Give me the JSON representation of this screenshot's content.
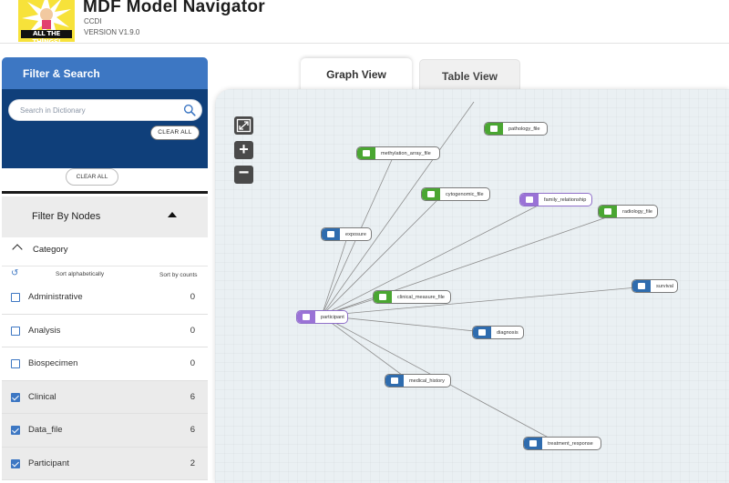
{
  "header": {
    "logo_banner": "ALL THE THINGS!",
    "title": "MDF Model Navigator",
    "subtitle": "CCDI",
    "version": "VERSION V1.9.0"
  },
  "filter": {
    "title": "Filter & Search",
    "search_placeholder": "Search in Dictionary",
    "clear_all_1": "CLEAR ALL",
    "clear_all_2": "CLEAR ALL",
    "filter_by_nodes": "Filter By Nodes",
    "category_label": "Category",
    "sort_alpha": "Sort alphabetically",
    "sort_counts": "Sort by counts",
    "categories": [
      {
        "label": "Administrative",
        "count": "0",
        "checked": false
      },
      {
        "label": "Analysis",
        "count": "0",
        "checked": false
      },
      {
        "label": "Biospecimen",
        "count": "0",
        "checked": false
      },
      {
        "label": "Clinical",
        "count": "6",
        "checked": true
      },
      {
        "label": "Data_file",
        "count": "6",
        "checked": true
      },
      {
        "label": "Participant",
        "count": "2",
        "checked": true
      }
    ]
  },
  "tabs": {
    "graph": "Graph View",
    "table": "Table View"
  },
  "graph": {
    "nodes": [
      {
        "id": "pathology_file",
        "label": "pathology_file",
        "kind": "green"
      },
      {
        "id": "methylation_array_file",
        "label": "methylation_array_file",
        "kind": "green"
      },
      {
        "id": "cytogenomic_file",
        "label": "cytogenomic_file",
        "kind": "green"
      },
      {
        "id": "family_relationship",
        "label": "family_relationship",
        "kind": "purple"
      },
      {
        "id": "radiology_file",
        "label": "radiology_file",
        "kind": "green"
      },
      {
        "id": "exposure",
        "label": "exposure",
        "kind": "blue"
      },
      {
        "id": "survival",
        "label": "survival",
        "kind": "blue"
      },
      {
        "id": "clinical_measure_file",
        "label": "clinical_measure_file",
        "kind": "green"
      },
      {
        "id": "participant",
        "label": "participant",
        "kind": "purple"
      },
      {
        "id": "diagnosis",
        "label": "diagnosis",
        "kind": "blue"
      },
      {
        "id": "medical_history",
        "label": "medical_history",
        "kind": "blue"
      },
      {
        "id": "treatment_response",
        "label": "treatment_response",
        "kind": "blue"
      }
    ]
  }
}
